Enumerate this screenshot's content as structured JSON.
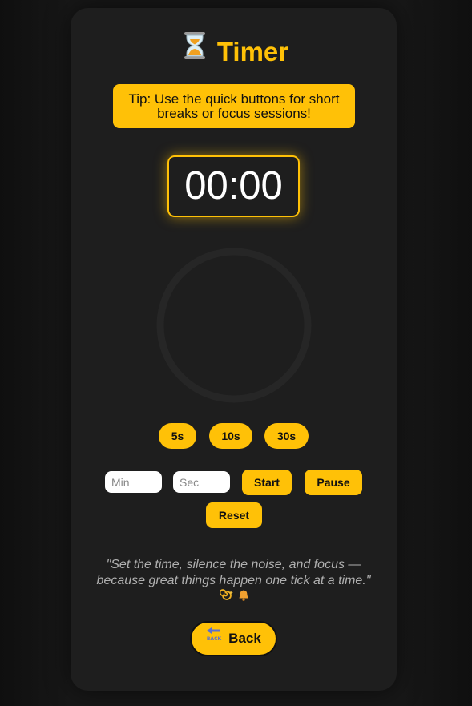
{
  "header": {
    "title": "Timer",
    "icon": "hourglass-icon"
  },
  "tip": {
    "text": "Tip: Use the quick buttons for short breaks or focus sessions!"
  },
  "timer": {
    "display": "00:00"
  },
  "quick_buttons": [
    {
      "label": "5s"
    },
    {
      "label": "10s"
    },
    {
      "label": "30s"
    }
  ],
  "inputs": {
    "minutes_placeholder": "Min",
    "seconds_placeholder": "Sec",
    "minutes_value": "",
    "seconds_value": ""
  },
  "controls": {
    "start_label": "Start",
    "pause_label": "Pause",
    "reset_label": "Reset"
  },
  "quote": {
    "text": "\"Set the time, silence the noise, and focus — because great things happen one tick at a time.\""
  },
  "back": {
    "label": "Back",
    "icon": "back-arrow-icon",
    "icon_caption": "BACK"
  },
  "colors": {
    "accent": "#ffc107",
    "background": "#1e1e1e",
    "text_light": "#ffffff",
    "quote_text": "#b0b0b0"
  }
}
